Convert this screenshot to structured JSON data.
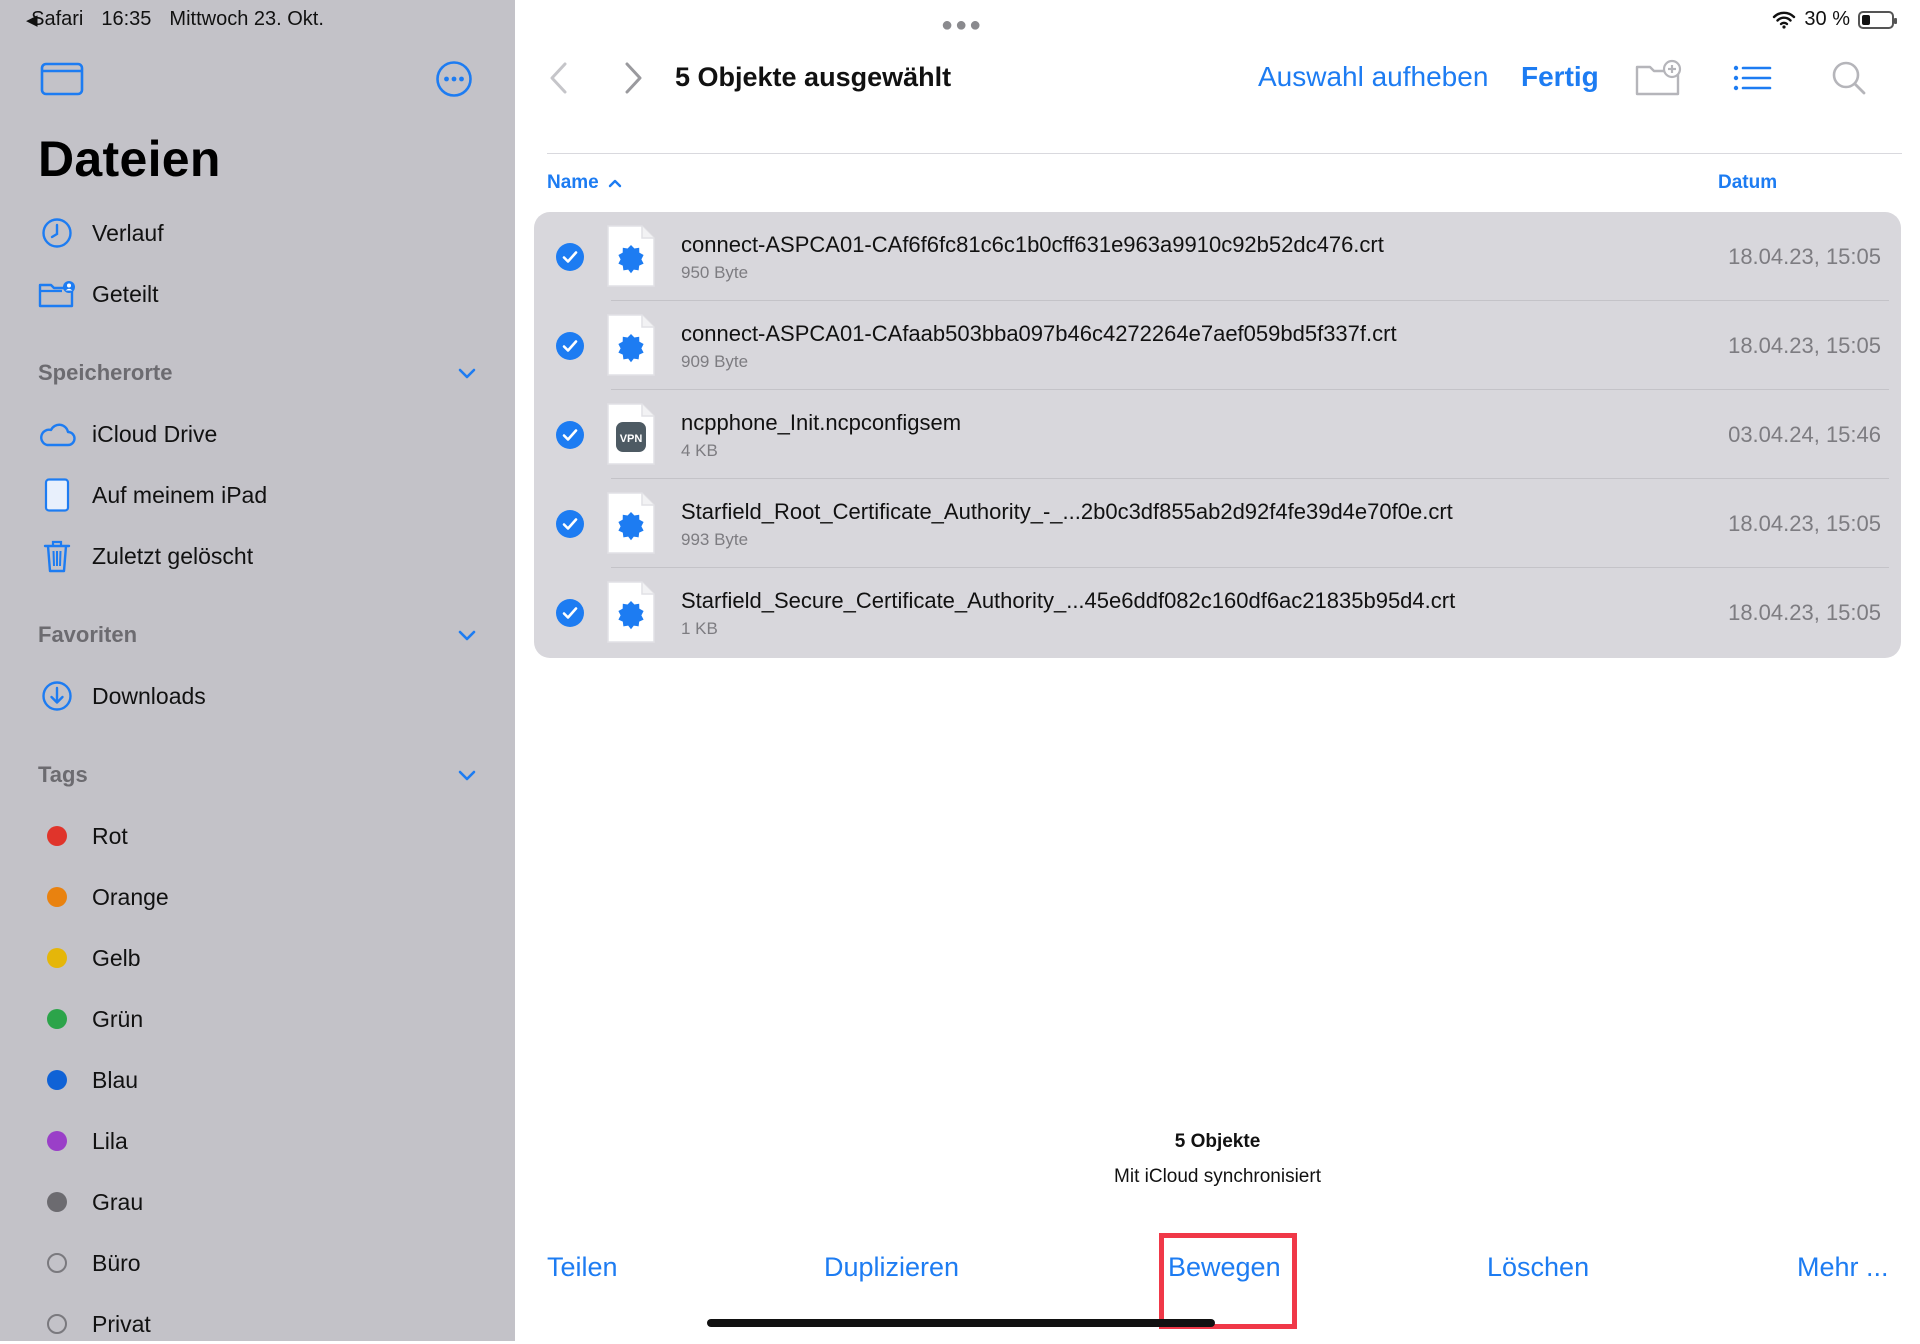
{
  "status_bar": {
    "back_app": "Safari",
    "time": "16:35",
    "date": "Mittwoch 23. Okt.",
    "battery": "30 %",
    "battery_level": 0.3
  },
  "sidebar": {
    "title": "Dateien",
    "top_items": [
      {
        "label": "Verlauf",
        "icon": "clock-icon"
      },
      {
        "label": "Geteilt",
        "icon": "shared-folder-icon"
      }
    ],
    "locations": {
      "heading": "Speicherorte",
      "items": [
        {
          "label": "iCloud Drive",
          "icon": "cloud-icon"
        },
        {
          "label": "Auf meinem iPad",
          "icon": "ipad-icon"
        },
        {
          "label": "Zuletzt gelöscht",
          "icon": "trash-icon"
        }
      ]
    },
    "favorites": {
      "heading": "Favoriten",
      "items": [
        {
          "label": "Downloads",
          "icon": "download-icon"
        }
      ]
    },
    "tags": {
      "heading": "Tags",
      "items": [
        {
          "label": "Rot",
          "color": "#e0342b"
        },
        {
          "label": "Orange",
          "color": "#e9820f"
        },
        {
          "label": "Gelb",
          "color": "#e5b609"
        },
        {
          "label": "Grün",
          "color": "#2ca44a"
        },
        {
          "label": "Blau",
          "color": "#0f62d6"
        },
        {
          "label": "Lila",
          "color": "#9a3fc8"
        },
        {
          "label": "Grau",
          "color": "#6c6b70"
        },
        {
          "label": "Büro",
          "color": ""
        },
        {
          "label": "Privat",
          "color": ""
        }
      ]
    }
  },
  "toolbar": {
    "title": "5 Objekte ausgewählt",
    "deselect_label": "Auswahl aufheben",
    "done_label": "Fertig"
  },
  "columns": {
    "name": "Name",
    "date": "Datum"
  },
  "files": [
    {
      "name": "connect-ASPCA01-CAf6f6fc81c6c1b0cff631e963a9910c92b52dc476.crt",
      "size": "950 Byte",
      "date": "18.04.23, 15:05",
      "icon": "certificate-icon",
      "selected": true
    },
    {
      "name": "connect-ASPCA01-CAfaab503bba097b46c4272264e7aef059bd5f337f.crt",
      "size": "909 Byte",
      "date": "18.04.23, 15:05",
      "icon": "certificate-icon",
      "selected": true
    },
    {
      "name": "ncpphone_Init.ncpconfigsem",
      "size": "4 KB",
      "date": "03.04.24, 15:46",
      "icon": "vpn-icon",
      "icon_label": "VPN",
      "selected": true
    },
    {
      "name": "Starfield_Root_Certificate_Authority_-_...2b0c3df855ab2d92f4fe39d4e70f0e.crt",
      "size": "993 Byte",
      "date": "18.04.23, 15:05",
      "icon": "certificate-icon",
      "selected": true
    },
    {
      "name": "Starfield_Secure_Certificate_Authority_...45e6ddf082c160df6ac21835b95d4.crt",
      "size": "1 KB",
      "date": "18.04.23, 15:05",
      "icon": "certificate-icon",
      "selected": true
    }
  ],
  "footer": {
    "count": "5 Objekte",
    "sync_status": "Mit iCloud synchronisiert"
  },
  "actions": {
    "share": "Teilen",
    "duplicate": "Duplizieren",
    "move": "Bewegen",
    "delete": "Löschen",
    "more": "Mehr ..."
  },
  "colors": {
    "accent": "#1d7cf2",
    "sidebar_bg": "#c3c2c8",
    "selection_bg": "#d8d7dc",
    "highlight": "#f03848"
  }
}
